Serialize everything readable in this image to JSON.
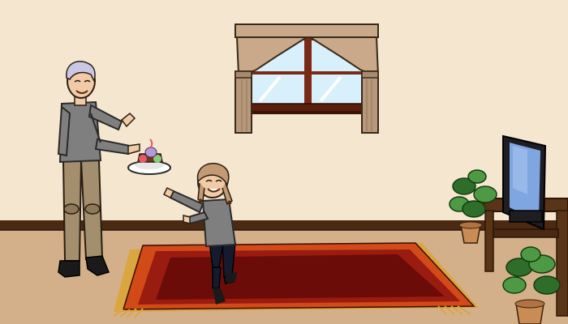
{
  "scene": {
    "elements": [
      "wall",
      "baseboard",
      "floor",
      "window",
      "curtains",
      "grandfather",
      "cake-plate",
      "girl",
      "rug",
      "tv-stand",
      "tv",
      "potted-plant"
    ]
  },
  "colors": {
    "wall": "#f5e6cf",
    "wall_shade": "#eddabe",
    "baseboard": "#4a2a12",
    "floor": "#d3b08a",
    "window_frame": "#7a2a14",
    "window_glass": "#d8f0fb",
    "curtain": "#c9a98a",
    "curtain_dark": "#a88a6e",
    "rug_outer": "#d24a18",
    "rug_mid": "#9a1c10",
    "rug_inner": "#6c0c08",
    "fringe": "#d9a640",
    "tv_stand": "#5a3416",
    "tv_body": "#1e1e22",
    "tv_screen": "#7fa6e0",
    "plant_leaf": "#2f6e2a",
    "plant_leaf_light": "#4e9a44",
    "pot": "#c98c55",
    "shirt": "#7f7f7f",
    "pants_old": "#a38f6e",
    "pants_girl": "#141b2e",
    "hair_old": "#c9c6e6",
    "hair_girl": "#c39a74",
    "skin": "#f1cba7"
  }
}
